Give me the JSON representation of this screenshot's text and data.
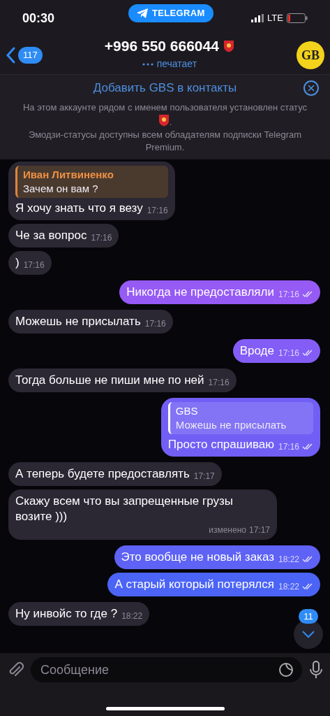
{
  "status_bar": {
    "time": "00:30",
    "app_pill": "TELEGRAM",
    "network": "LTE"
  },
  "header": {
    "back_count": "117",
    "title": "+996 550 666044",
    "status": "печатает",
    "avatar": "GB"
  },
  "banner": {
    "action": "Добавить GBS в контакты",
    "description_1": "На этом аккаунте рядом с именем пользователя установлен статус",
    "description_2": ".",
    "description_3": "Эмодзи-статусы доступны всем обладателям подписки Telegram Premium."
  },
  "messages": [
    {
      "kind": "incoming",
      "reply": {
        "name": "Иван Литвиненко",
        "text": "Зачем он вам ?"
      },
      "text": "Я хочу знать что я везу",
      "time": "17:16"
    },
    {
      "kind": "incoming",
      "text": "Че за вопрос",
      "time": "17:16"
    },
    {
      "kind": "incoming",
      "text": ")",
      "time": "17:16"
    },
    {
      "kind": "outgoing",
      "text": "Никогда не предоставляли",
      "time": "17:16",
      "read": true
    },
    {
      "kind": "incoming",
      "text": "Можешь не присылать",
      "time": "17:16"
    },
    {
      "kind": "outgoing",
      "text": "Вроде",
      "time": "17:16",
      "read": true
    },
    {
      "kind": "incoming",
      "text": "Тогда больше не пиши мне по ней",
      "time": "17:16"
    },
    {
      "kind": "outgoing",
      "reply": {
        "name": "GBS",
        "text": "Можешь не присылать"
      },
      "text": "Просто спрашиваю",
      "time": "17:16",
      "read": true
    },
    {
      "kind": "incoming",
      "text": "А теперь будете предоставлять",
      "time": "17:17"
    },
    {
      "kind": "incoming",
      "text": "Скажу всем что вы запрещенные грузы возите )))",
      "time": "17:17",
      "edited": "изменено"
    },
    {
      "kind": "outgoing",
      "text": "Это вообще не новый заказ",
      "time": "18:22",
      "read": true
    },
    {
      "kind": "outgoing",
      "text": "А старый который потерялся",
      "time": "18:22",
      "read": true
    },
    {
      "kind": "incoming",
      "text": "Ну инвойс то где ?",
      "time": "18:22"
    }
  ],
  "scroll_down": {
    "unread": "11"
  },
  "composer": {
    "placeholder": "Сообщение"
  }
}
